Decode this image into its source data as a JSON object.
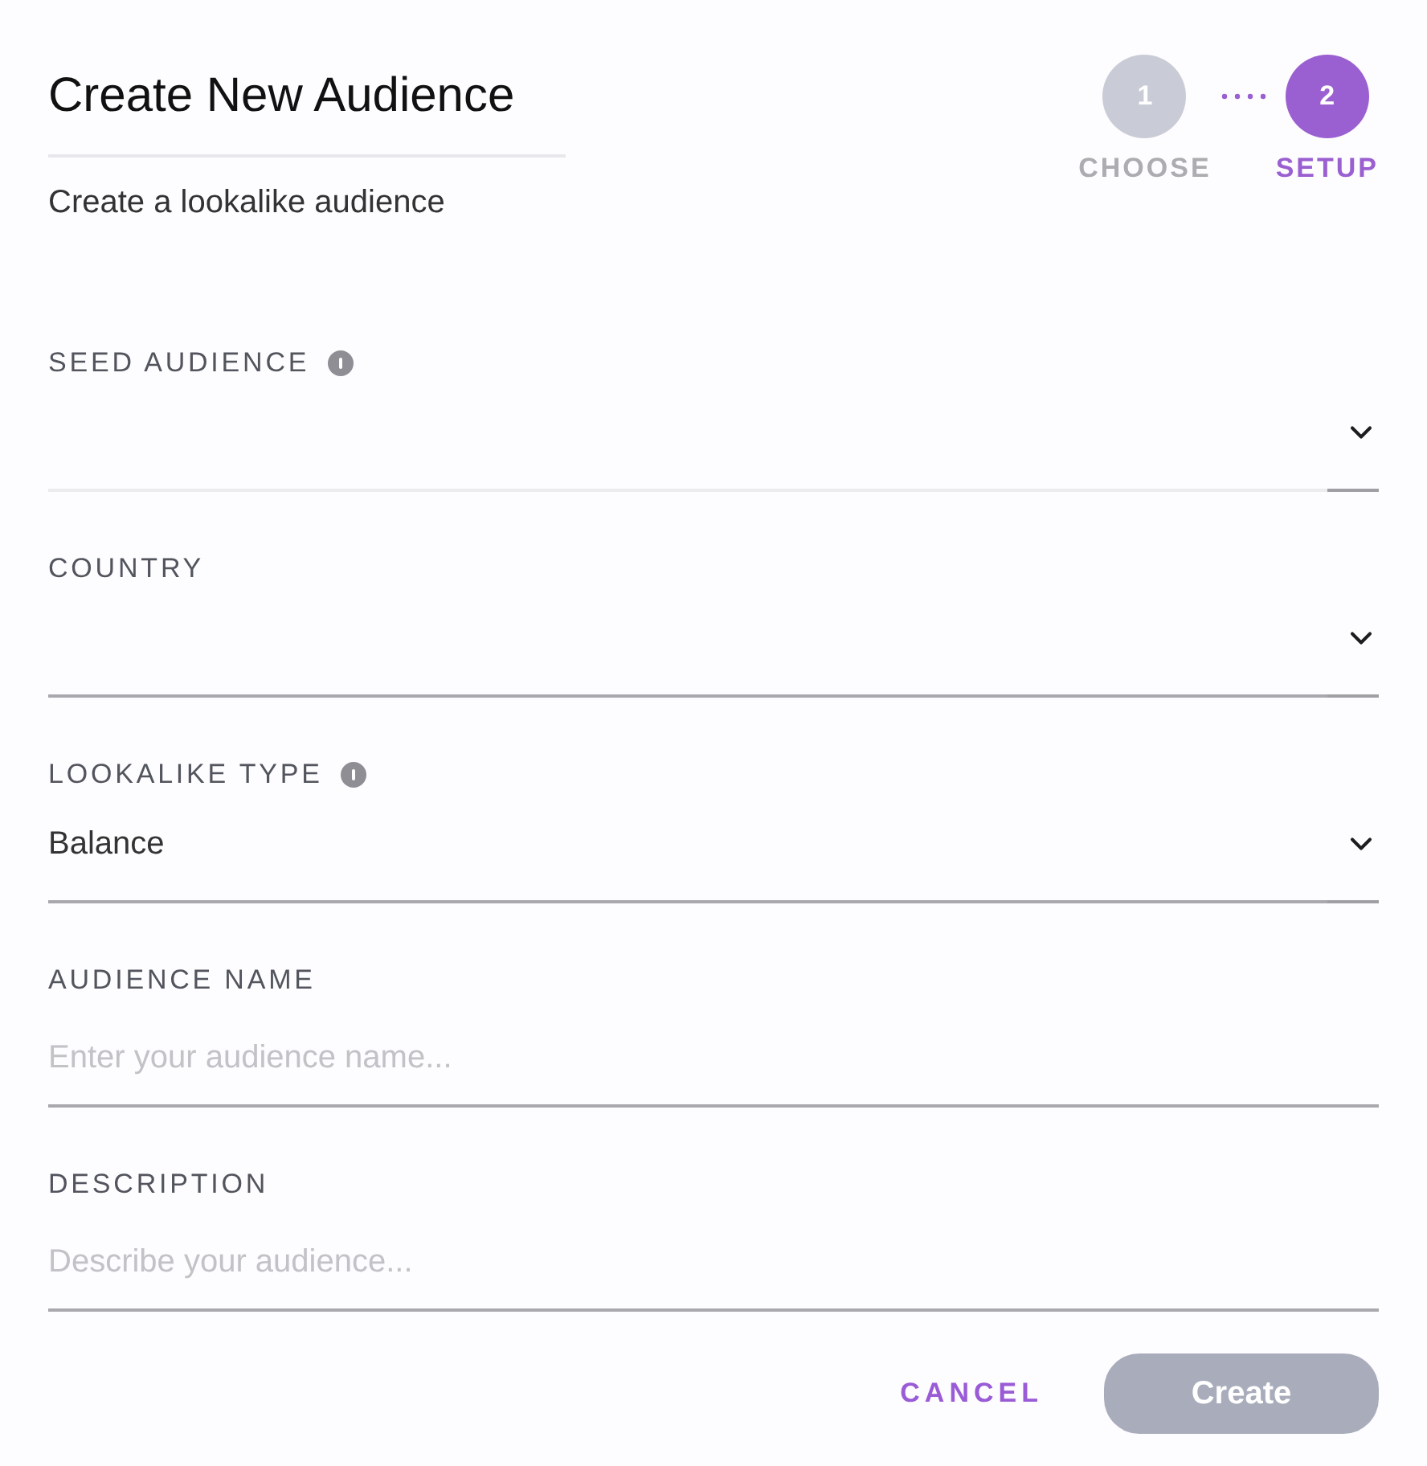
{
  "header": {
    "title": "Create New Audience",
    "subtitle": "Create a lookalike audience"
  },
  "stepper": {
    "steps": [
      {
        "number": "1",
        "label": "CHOOSE",
        "selected": false
      },
      {
        "number": "2",
        "label": "SETUP",
        "selected": true
      }
    ]
  },
  "fields": [
    {
      "kind": "select",
      "label": "SEED AUDIENCE",
      "info": true,
      "disabled": true
    },
    {
      "kind": "select",
      "label": "COUNTRY",
      "disabled": false
    },
    {
      "kind": "select",
      "label": "LOOKALIKE TYPE",
      "info": true,
      "value": "Balance",
      "disabled": false
    },
    {
      "kind": "text",
      "label": "AUDIENCE NAME",
      "placeholder": "Enter your audience name..."
    },
    {
      "kind": "text",
      "label": "DESCRIPTION",
      "placeholder": "Describe your audience..."
    }
  ],
  "buttons": [
    {
      "kind": "link",
      "label": "CANCEL",
      "disabled": false
    },
    {
      "kind": "primary",
      "label": "Create",
      "disabled": true
    }
  ]
}
